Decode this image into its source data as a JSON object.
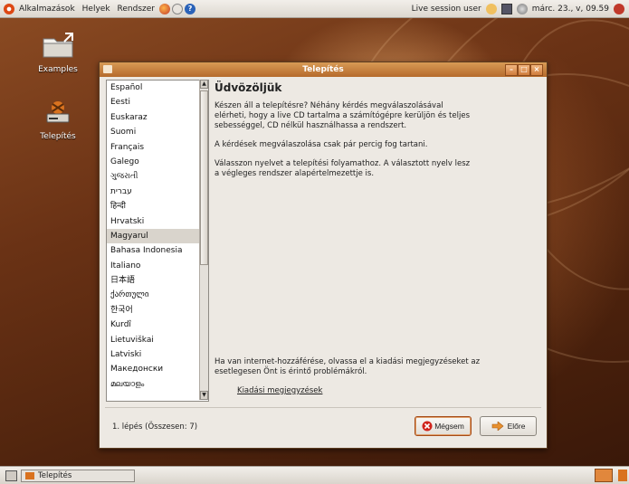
{
  "top_panel": {
    "menu_applications": "Alkalmazások",
    "menu_places": "Helyek",
    "menu_system": "Rendszer",
    "user": "Live session user",
    "datetime": "márc. 23., v, 09.59"
  },
  "desktop": {
    "icon_examples": "Examples",
    "icon_install": "Telepítés"
  },
  "window": {
    "title": "Telepítés",
    "languages": [
      "Español",
      "Eesti",
      "Euskaraz",
      "Suomi",
      "Français",
      "Galego",
      "ગુજરાતી",
      "עברית",
      "हिन्दी",
      "Hrvatski",
      "Magyarul",
      "Bahasa Indonesia",
      "Italiano",
      "日本語",
      "ქართული",
      "한국어",
      "Kurdî",
      "Lietuviškai",
      "Latviski",
      "Македонски",
      "മലയാളം"
    ],
    "selected_language": "Magyarul",
    "heading": "Üdvözöljük",
    "para1": "Készen áll a telepítésre? Néhány kérdés megválaszolásával elérheti, hogy a live CD tartalma a számítógépre kerüljön és teljes sebességgel, CD nélkül használhassa a rendszert.",
    "para2": "A kérdések megválaszolása csak pár percig fog tartani.",
    "para3": "Válasszon nyelvet a telepítési folyamathoz. A választott nyelv lesz a végleges rendszer alapértelmezettje is.",
    "internet_note": "Ha van internet-hozzáférése, olvassa el a kiadási megjegyzéseket az esetlegesen Önt is érintő problémákról.",
    "release_link": "Kiadási megjegyzések",
    "step": "1. lépés (Összesen: 7)",
    "cancel": "Mégsem",
    "forward": "Előre"
  },
  "bottom_panel": {
    "task": "Telepítés"
  },
  "colors": {
    "accent": "#c56b2a",
    "selection": "#d9d4cc"
  }
}
